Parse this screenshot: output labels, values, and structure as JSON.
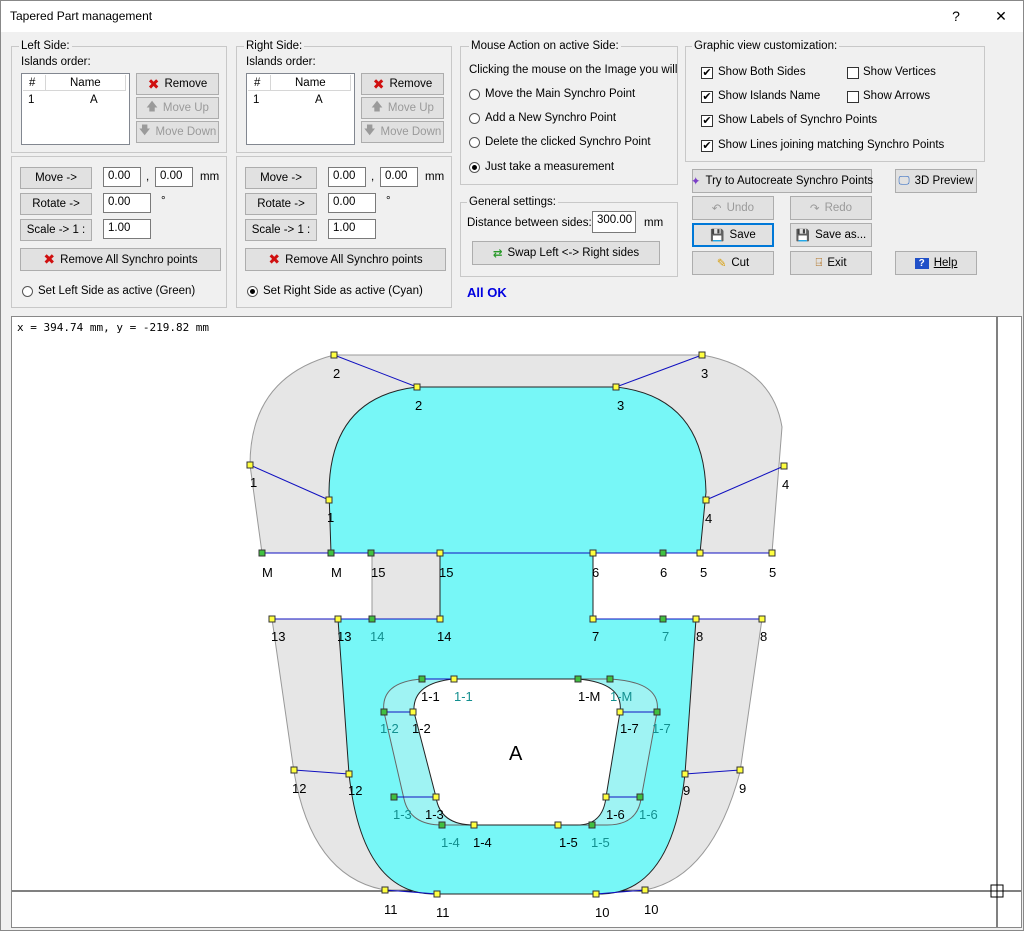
{
  "window": {
    "title": "Tapered Part management",
    "help_btn": "?",
    "close_btn": "✕"
  },
  "left": {
    "legend": "Left Side:",
    "islands_label": "Islands order:",
    "col_num": "#",
    "col_name": "Name",
    "row_num": "1",
    "row_name": "A",
    "remove": "Remove",
    "move_up": "Move Up",
    "move_down": "Move Down",
    "move": "Move ->",
    "rotate": "Rotate ->",
    "scale": "Scale -> 1 :",
    "move_x": "0.00",
    "move_y": "0.00",
    "rotate_val": "0.00",
    "scale_val": "1.00",
    "unit_mm": "mm",
    "sep_comma": ",",
    "unit_deg": "°",
    "remove_all": "Remove All Synchro points",
    "set_active": "Set Left Side as active (Green)"
  },
  "right": {
    "legend": "Right Side:",
    "islands_label": "Islands order:",
    "col_num": "#",
    "col_name": "Name",
    "row_num": "1",
    "row_name": "A",
    "remove": "Remove",
    "move_up": "Move Up",
    "move_down": "Move Down",
    "move": "Move ->",
    "rotate": "Rotate ->",
    "scale": "Scale -> 1 :",
    "move_x": "0.00",
    "move_y": "0.00",
    "rotate_val": "0.00",
    "scale_val": "1.00",
    "unit_mm": "mm",
    "sep_comma": ",",
    "unit_deg": "°",
    "remove_all": "Remove All Synchro points",
    "set_active": "Set Right Side as active (Cyan)"
  },
  "mouse": {
    "legend": "Mouse Action on active Side:",
    "intro": "Clicking the mouse on the Image you will",
    "options": [
      "Move the Main Synchro Point",
      "Add a New Synchro Point",
      "Delete the clicked Synchro Point",
      "Just take a measurement"
    ],
    "selected": 3
  },
  "general": {
    "legend": "General settings:",
    "distance_label": "Distance between sides:",
    "distance_val": "300.00",
    "unit": "mm",
    "swap": "Swap Left <-> Right sides"
  },
  "status": "All OK",
  "graphic": {
    "legend": "Graphic view customization:",
    "show_both": "Show Both Sides",
    "show_vertices": "Show Vertices",
    "show_islands": "Show Islands Name",
    "show_arrows": "Show Arrows",
    "show_labels": "Show Labels of Synchro Points",
    "show_lines": "Show Lines joining matching Synchro Points"
  },
  "actions": {
    "autocreate": "Try to Autocreate Synchro Points",
    "preview": "3D Preview",
    "undo": "Undo",
    "redo": "Redo",
    "save": "Save",
    "save_as": "Save as...",
    "cut": "Cut",
    "exit": "Exit",
    "help": "Help"
  },
  "canvas": {
    "coords": "x = 394.74 mm, y = -219.82 mm",
    "island_name": "A",
    "outer_labels": [
      "2",
      "3",
      "1",
      "4",
      "M",
      "5",
      "13",
      "8",
      "12",
      "9",
      "11",
      "10"
    ],
    "inner_labels": [
      "2",
      "3",
      "1",
      "4",
      "M",
      "15",
      "6",
      "5",
      "13",
      "14",
      "7",
      "8",
      "12",
      "9",
      "11",
      "10"
    ],
    "left_shadow_labels": [
      "15",
      "6",
      "14",
      "7"
    ],
    "island_inner": [
      "1-1",
      "1-M",
      "1-2",
      "1-7",
      "1-3",
      "1-6",
      "1-4",
      "1-5"
    ],
    "island_outer": [
      "1-1",
      "1-M",
      "1-2",
      "1-7",
      "1-3",
      "1-6",
      "1-4",
      "1-5"
    ]
  },
  "colors": {
    "cyan": "#77f7f7",
    "grey": "#e6e6e6",
    "teal": "#138f8f",
    "link": "#0000e0"
  }
}
